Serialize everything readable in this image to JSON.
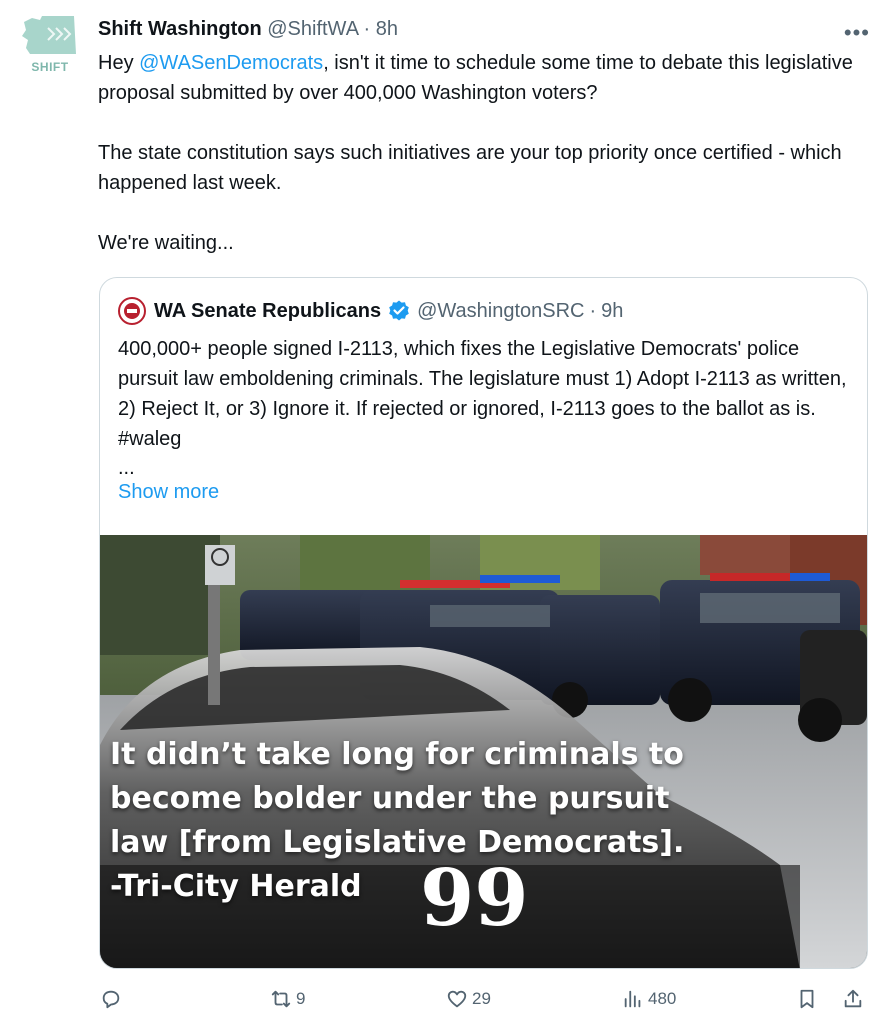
{
  "author": {
    "name": "Shift Washington",
    "handle": "@ShiftWA",
    "separator": "·",
    "time": "8h",
    "avatar_label": "SHIFT",
    "avatar_color": "#a8d5cb"
  },
  "more_icon": "more-horizontal-icon",
  "tweet": {
    "line1_prefix": "Hey ",
    "mention": "@WASenDemocrats",
    "line1_suffix": ", isn't it time to schedule some time to debate this legislative proposal submitted by over 400,000 Washington voters?",
    "paragraph2": "The state constitution says such initiatives are your top priority once certified - which happened last week.",
    "paragraph3": "We're waiting..."
  },
  "quoted": {
    "name": "WA Senate Republicans",
    "handle": "@WashingtonSRC",
    "separator": "·",
    "time": "9h",
    "verified": true,
    "verified_color": "#1d9bf0",
    "text": "400,000+ people signed I-2113, which fixes the Legislative Democrats' police pursuit law emboldening criminals. The legislature must 1) Adopt I-2113 as written, 2) Reject It, or 3) Ignore it. If rejected or ignored, I-2113 goes to the ballot as is. #waleg",
    "ellipsis": "...",
    "show_more": "Show more",
    "image": {
      "description_icon": "police-cars-photo",
      "overlay_lines": [
        "It didn’t take long for criminals to",
        "become bolder under the pursuit",
        "law [from Legislative Democrats].",
        "-Tri-City Herald"
      ],
      "quote_mark": "99"
    }
  },
  "actions": {
    "reply": {
      "icon": "reply-icon",
      "count": ""
    },
    "retweet": {
      "icon": "retweet-icon",
      "count": "9"
    },
    "like": {
      "icon": "heart-icon",
      "count": "29"
    },
    "views": {
      "icon": "views-icon",
      "count": "480"
    },
    "bookmark": {
      "icon": "bookmark-icon",
      "count": ""
    },
    "share": {
      "icon": "share-icon",
      "count": ""
    }
  },
  "colors": {
    "link": "#1d9bf0",
    "secondary_text": "#536471",
    "border": "#cfd9de"
  }
}
